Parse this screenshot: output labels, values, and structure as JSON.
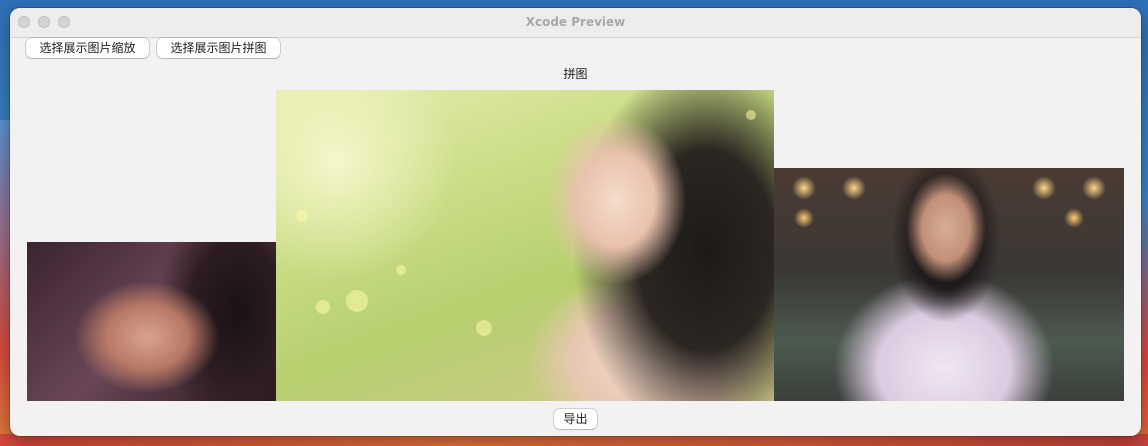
{
  "window": {
    "title": "Xcode Preview"
  },
  "toolbar": {
    "scale_button_label": "选择展示图片缩放",
    "stitch_button_label": "选择展示图片拼图"
  },
  "main": {
    "section_title": "拼图",
    "images": [
      {
        "description": "portrait-photo-left"
      },
      {
        "description": "portrait-photo-center"
      },
      {
        "description": "portrait-photo-right"
      }
    ],
    "export_button_label": "导出"
  },
  "colors": {
    "window_background": "#f3f1f2",
    "titlebar_background": "#eeecec",
    "title_text": "#a9a7a8",
    "button_background": "#ffffff",
    "text": "#1e1e1e"
  }
}
